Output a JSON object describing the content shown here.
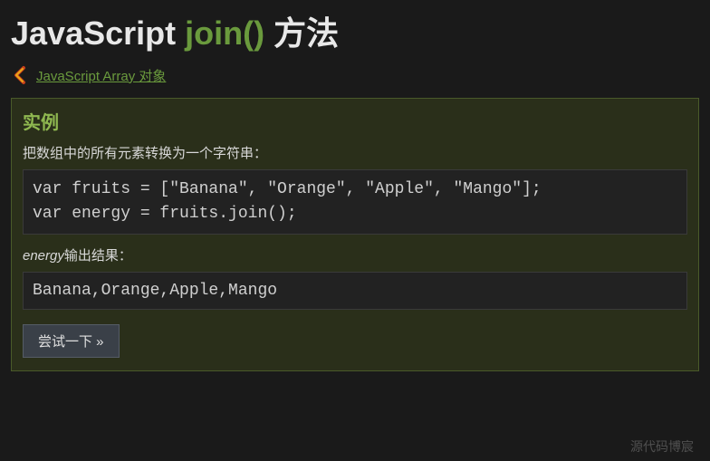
{
  "heading": {
    "prefix": "JavaScript ",
    "method": "join()",
    "suffix": " 方法"
  },
  "breadcrumb": {
    "link_text": "JavaScript Array 对象"
  },
  "example": {
    "title": "实例",
    "description": "把数组中的所有元素转换为一个字符串：",
    "code": "var fruits = [\"Banana\", \"Orange\", \"Apple\", \"Mango\"];\nvar energy = fruits.join();",
    "output_var": "energy",
    "output_label_suffix": "输出结果：",
    "output": "Banana,Orange,Apple,Mango",
    "try_button": "尝试一下 »"
  },
  "watermark": "源代码博宸"
}
